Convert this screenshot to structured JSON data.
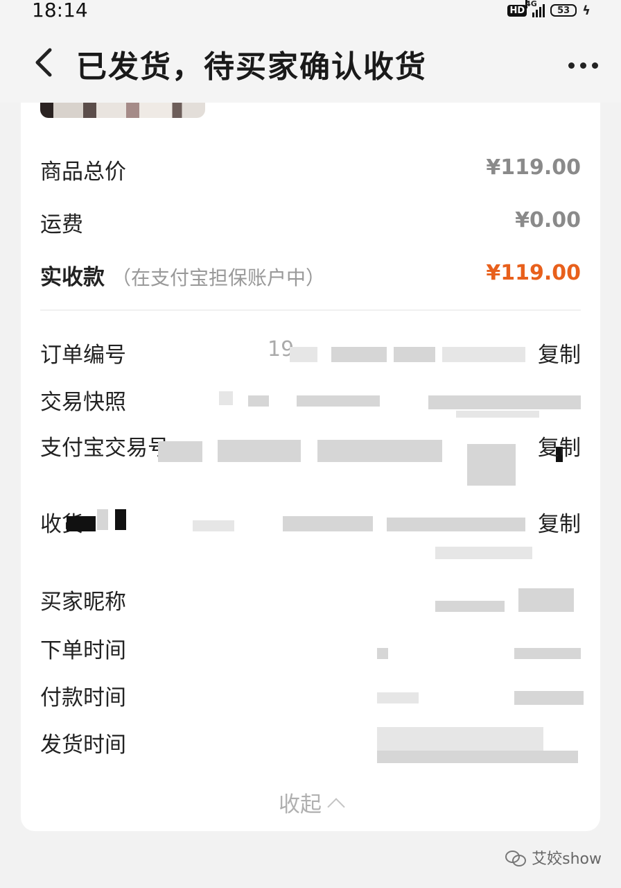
{
  "status_bar": {
    "time": "18:14",
    "hd_label": "HD",
    "network_label": "4G",
    "battery_level": "53"
  },
  "header": {
    "title": "已发货，待买家确认收货",
    "back_icon": "chevron-left-icon",
    "more_icon": "more-dots-icon"
  },
  "price_summary": {
    "subtotal_label": "商品总价",
    "subtotal_value": "¥119.00",
    "shipping_label": "运费",
    "shipping_value": "¥0.00",
    "received_label": "实收款",
    "received_note": "（在支付宝担保账户中）",
    "received_value": "¥119.00"
  },
  "order_info": {
    "order_number_label": "订单编号",
    "order_number_visible": "19",
    "snapshot_label": "交易快照",
    "alipay_label": "支付宝交易号",
    "address_label": "收货",
    "buyer_nickname_label": "买家昵称",
    "order_time_label": "下单时间",
    "payment_time_label": "付款时间",
    "ship_time_label": "发货时间",
    "copy_label": "复制",
    "collapse_label": "收起"
  },
  "watermark": {
    "text": "艾姣show"
  },
  "colors": {
    "accent": "#e8601c",
    "muted_value": "#8a8a8a",
    "background": "#f2f2f2"
  }
}
